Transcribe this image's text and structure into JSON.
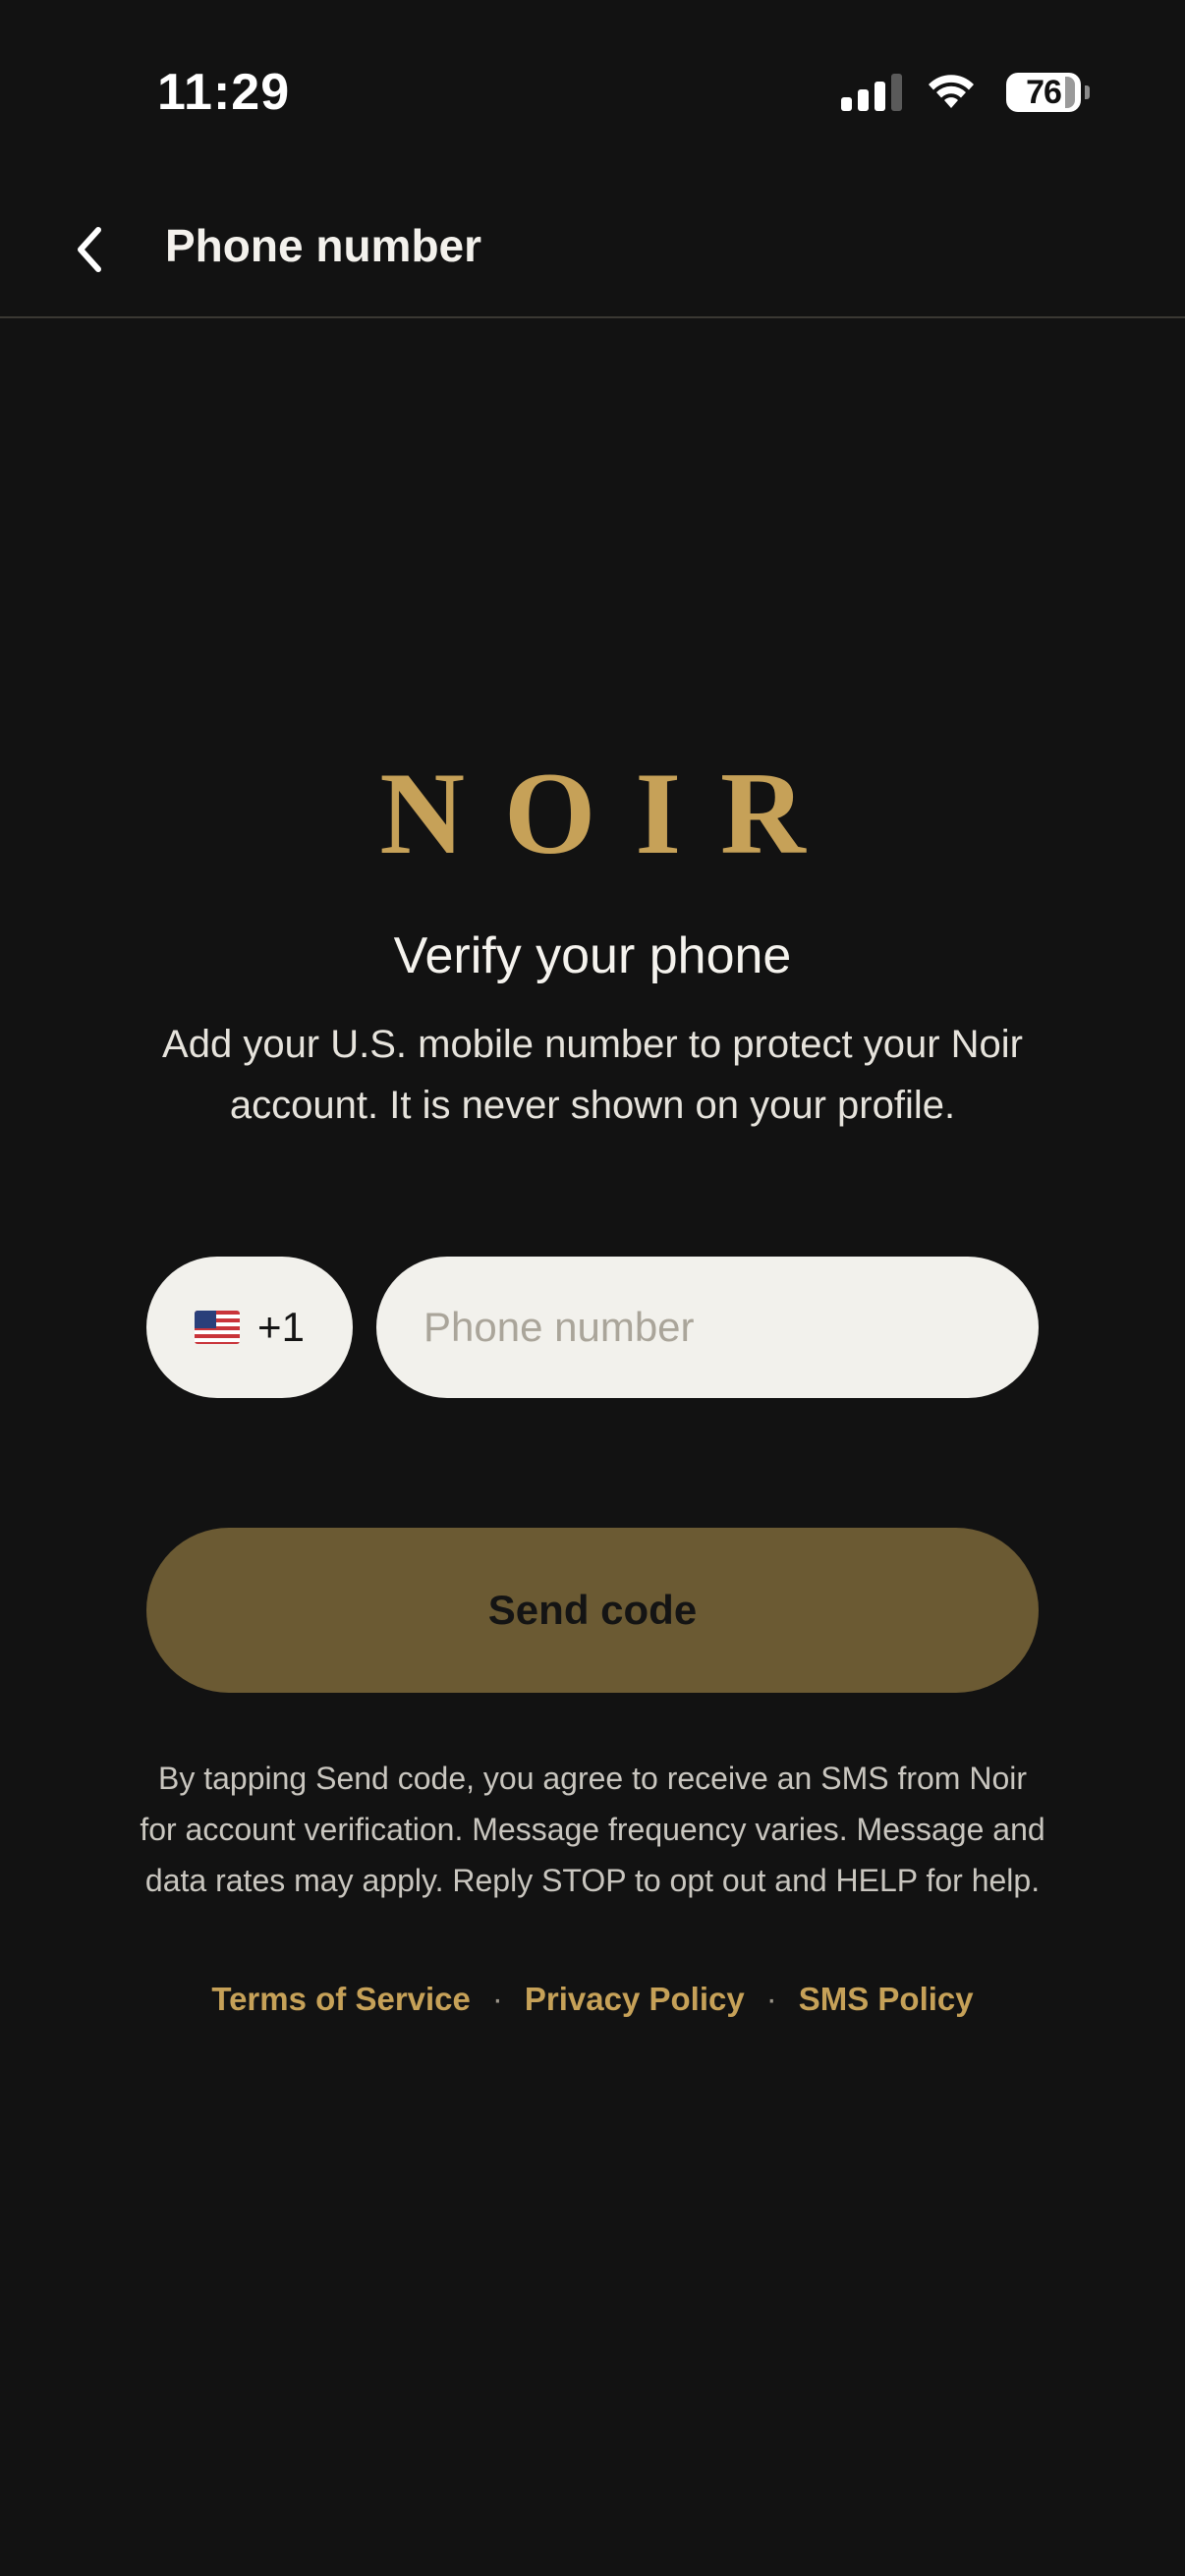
{
  "status_bar": {
    "time": "11:29",
    "battery": "76",
    "icons": [
      "cellular-signal-icon",
      "wifi-icon",
      "battery-icon"
    ]
  },
  "nav": {
    "back_icon": "chevron-left-icon",
    "title": "Phone number"
  },
  "logo_text": "NOIR",
  "heading": "Verify your phone",
  "subtext": "Add your U.S. mobile number to protect your Noir account. It is never shown on your profile.",
  "country_code": {
    "flag_icon": "us-flag-icon",
    "code": "+1"
  },
  "phone_input": {
    "value": "",
    "placeholder": "Phone number"
  },
  "send_button": "Send code",
  "disclaimer": "By tapping Send code, you agree to receive an SMS from Noir for account verification. Message frequency varies. Message and data rates may apply. Reply STOP to opt out and HELP for help.",
  "links": {
    "terms": "Terms of Service",
    "privacy": "Privacy Policy",
    "sms": "SMS Policy",
    "separator": "·"
  },
  "colors": {
    "background": "#121212",
    "accent_gold": "#c6a158",
    "button_disabled": "#6b5a33",
    "input_bg": "#f2f1ec"
  }
}
